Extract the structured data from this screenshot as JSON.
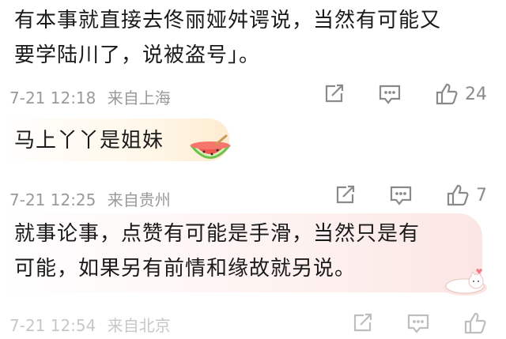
{
  "comments": [
    {
      "text_line1": "有本事就直接去佟丽娅舛谔说，当然有可能又",
      "text_line2": "要学陆川了，说被盗号」。",
      "time": "7-21 12:18",
      "location": "来自上海",
      "likes": "24"
    },
    {
      "text": "马上丫丫是姐妹",
      "time": "7-21 12:25",
      "location": "来自贵州",
      "likes": "7"
    },
    {
      "text_line1": "就事论事，点赞有可能是手滑，当然只是有",
      "text_line2": "可能，如果另有前情和缘故就另说。",
      "time": "7-21 12:54",
      "location": "来自北京"
    }
  ],
  "colors": {
    "meta": "#9a9a9a",
    "icon": "#8a8a8a"
  },
  "icons": [
    "share-icon",
    "comment-icon",
    "like-icon",
    "watermelon-sticker",
    "cat-sticker"
  ]
}
